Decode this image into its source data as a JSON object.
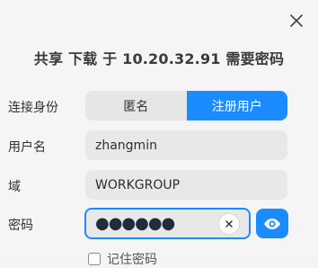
{
  "dialog": {
    "title": "共享 下载 于 10.20.32.91 需要密码"
  },
  "identity": {
    "label": "连接身份",
    "options": [
      "匿名",
      "注册用户"
    ],
    "selected": "注册用户"
  },
  "username": {
    "label": "用户名",
    "value": "zhangmin"
  },
  "domain": {
    "label": "域",
    "value": "WORKGROUP"
  },
  "password": {
    "label": "密码",
    "masked_value": "●●●●●●"
  },
  "remember": {
    "label": "记住密码",
    "checked": false
  },
  "icons": {
    "close": "close-icon",
    "clear": "clear-icon",
    "eye": "eye-icon"
  },
  "colors": {
    "accent": "#1a8cff",
    "field_bg": "#e8e8e8",
    "background": "#f5f5f5"
  }
}
